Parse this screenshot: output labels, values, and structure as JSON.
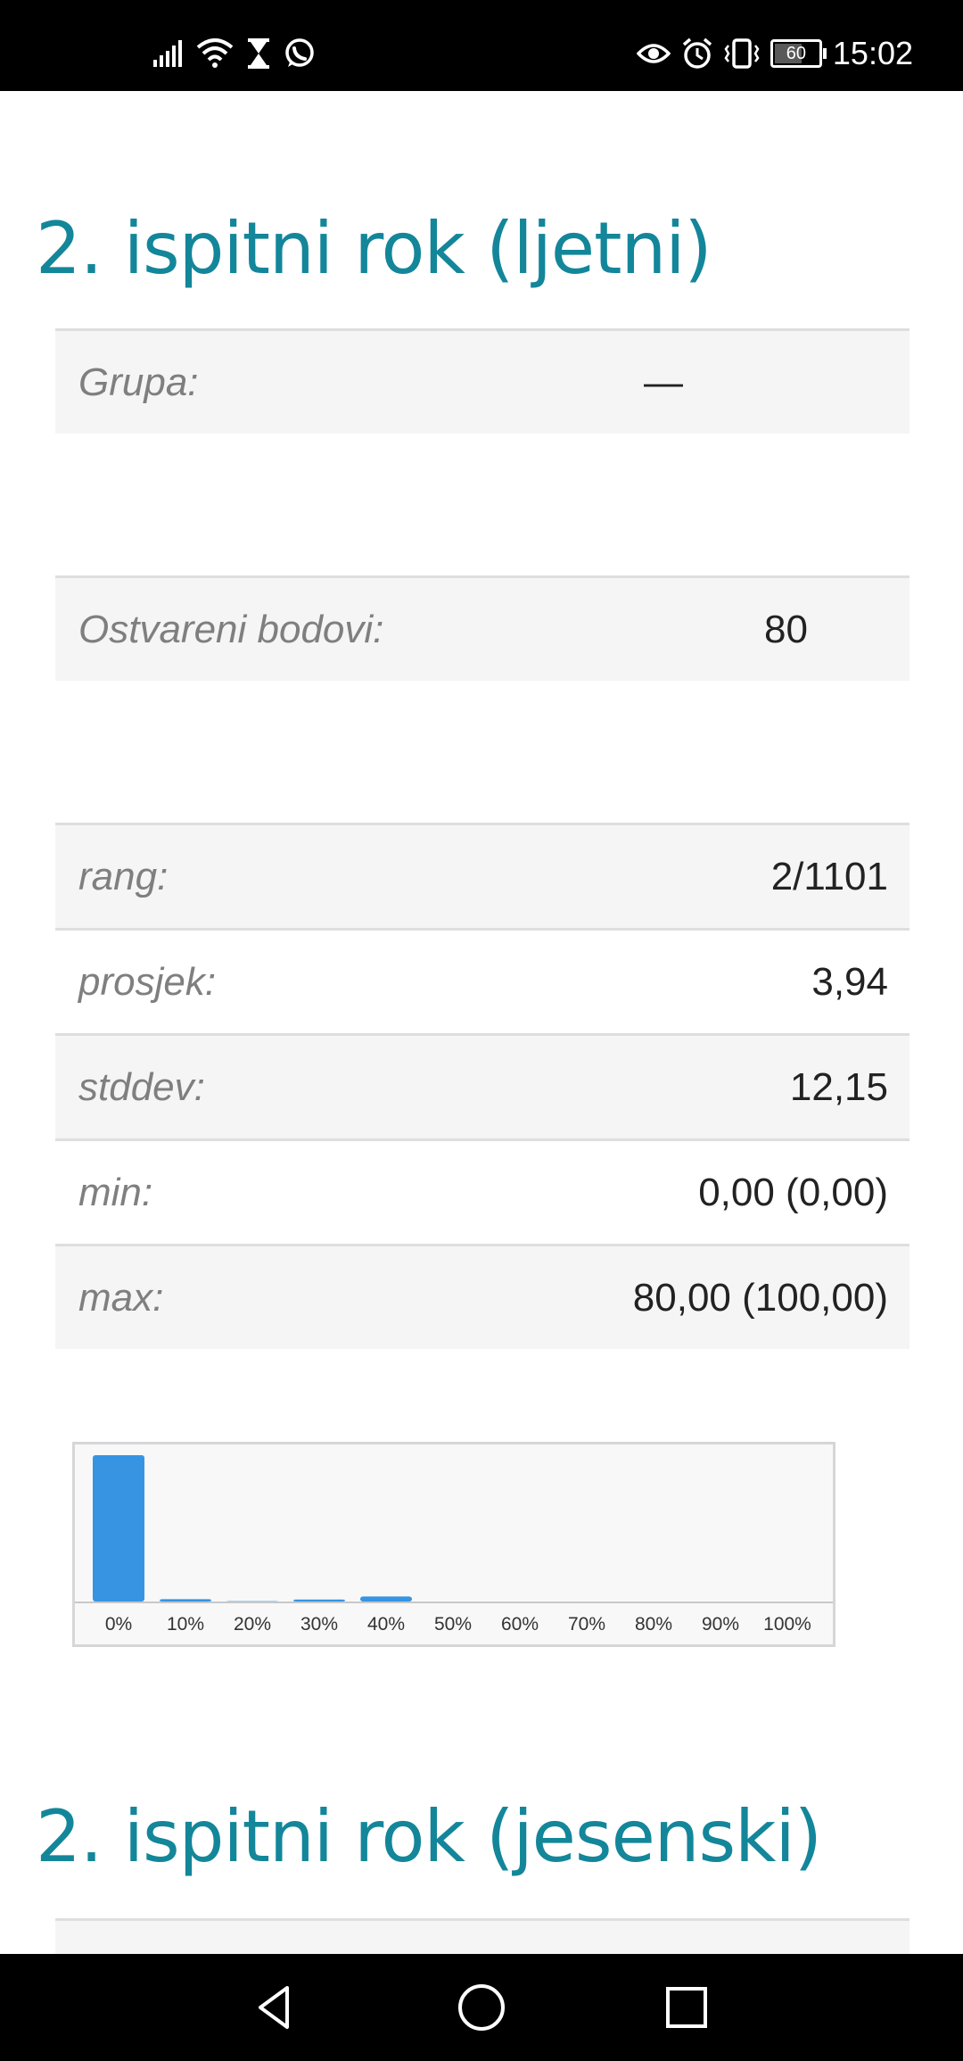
{
  "status_bar": {
    "time": "15:02",
    "battery": "60",
    "left_icons": [
      "signal-icon",
      "wifi-icon",
      "hourglass-icon",
      "whatsapp-icon"
    ],
    "right_icons": [
      "eye-icon",
      "alarm-icon",
      "vibrate-icon",
      "battery-icon"
    ]
  },
  "sections": [
    {
      "title": "2. ispitni rok (ljetni)",
      "group": {
        "label": "Grupa:",
        "value": "—"
      },
      "points": {
        "label": "Ostvareni bodovi:",
        "value": "80"
      },
      "stats": [
        {
          "label": "rang:",
          "value": "2/1101"
        },
        {
          "label": "prosjek:",
          "value": "3,94"
        },
        {
          "label": "stddev:",
          "value": "12,15"
        },
        {
          "label": "min:",
          "value": "0,00 (0,00)"
        },
        {
          "label": "max:",
          "value": "80,00 (100,00)"
        }
      ]
    },
    {
      "title": "2. ispitni rok (jesenski)"
    }
  ],
  "chart_data": {
    "type": "bar",
    "categories": [
      "0%",
      "10%",
      "20%",
      "30%",
      "40%",
      "50%",
      "60%",
      "70%",
      "80%",
      "90%",
      "100%"
    ],
    "values": [
      1000,
      16,
      2,
      14,
      34,
      0,
      0,
      0,
      0,
      0,
      0
    ],
    "bar_color": "#3694e3"
  },
  "colors": {
    "title": "#13869a",
    "row_shade": "#f5f5f5",
    "label": "#7f7f7f"
  },
  "nav_bar": {
    "icons": [
      "back-icon",
      "home-icon",
      "recents-icon"
    ]
  }
}
